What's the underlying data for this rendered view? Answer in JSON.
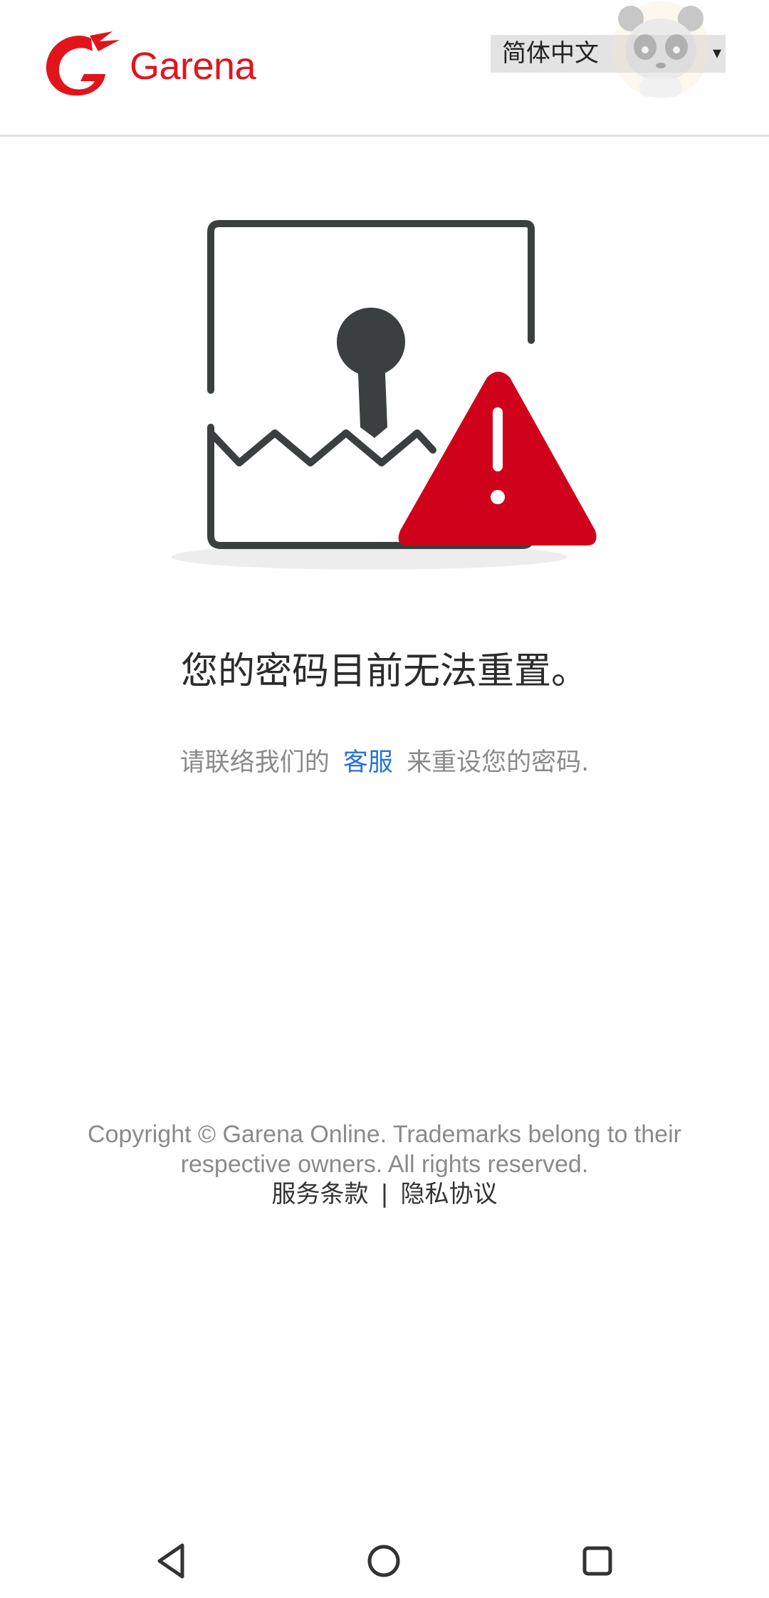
{
  "header": {
    "brand": "Garena",
    "language_selected": "简体中文",
    "language_caret": "▾"
  },
  "main": {
    "headline": "您的密码目前无法重置。",
    "sub_before": "请联络我们的",
    "sub_link": "客服",
    "sub_after": "来重设您的密码."
  },
  "footer": {
    "copyright": "Copyright © Garena Online. Trademarks belong to their respective owners. All rights reserved.",
    "terms": "服务条款",
    "separator": "|",
    "privacy": "隐私协议"
  },
  "icons": {
    "logo": "garena-logo-icon",
    "illustration": "locked-document-warning-icon",
    "avatar": "panda-avatar-icon",
    "back": "back-triangle-icon",
    "home": "home-circle-icon",
    "recent": "recent-square-icon"
  },
  "colors": {
    "brand": "#e2141b",
    "link": "#2673d6",
    "warning": "#d0021b",
    "icon_dark": "#3b3f3f",
    "muted_text": "#8a8a8a"
  }
}
